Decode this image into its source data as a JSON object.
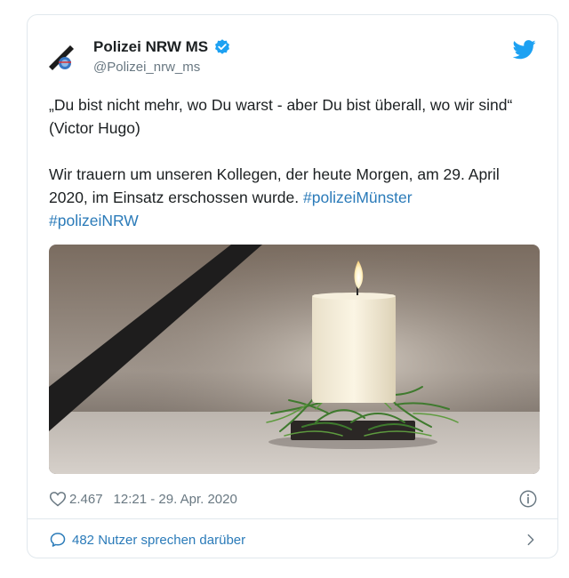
{
  "tweet": {
    "author": {
      "name": "Polizei NRW MS",
      "handle": "@Polizei_nrw_ms",
      "verified_icon": "verified-badge-icon"
    },
    "text": {
      "quote": "„Du bist nicht mehr, wo Du warst - aber Du bist überall, wo wir sind“ (Victor Hugo)",
      "body": "Wir trauern um unseren Kollegen, der heute Morgen, am 29. April 2020, im Einsatz erschossen wurde.",
      "hashtags": [
        "#polizeiMünster",
        "#polizeiNRW"
      ]
    },
    "media": {
      "icon": "candle-image"
    },
    "meta": {
      "likes": "2.467",
      "timestamp": "12:21 - 29. Apr. 2020"
    },
    "replies": {
      "label": "482 Nutzer sprechen darüber"
    }
  },
  "colors": {
    "link": "#2b7bb9",
    "muted": "#697882",
    "twitter_blue": "#1da1f2",
    "border": "#e1e8ed"
  }
}
